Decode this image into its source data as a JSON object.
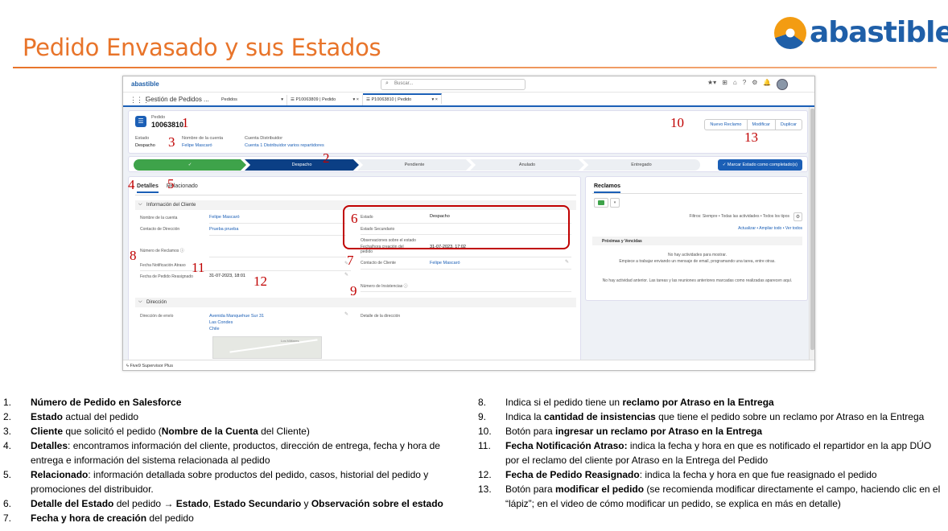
{
  "slide": {
    "title": "Pedido Envasado y sus Estados",
    "logo_text": "abastible"
  },
  "shot": {
    "sf_logo": "abastible",
    "search_placeholder": "Buscar...",
    "top_icons": [
      "★▾",
      "⊞",
      "⌂",
      "?",
      "⚙",
      "🔔"
    ],
    "app_name": "Gestión de Pedidos ...",
    "nav_tabs": [
      {
        "label": "Pedidos",
        "suffix": "▾"
      },
      {
        "label": "P10063809 | Pedido",
        "suffix": "▾ ×"
      },
      {
        "label": "P10063810 | Pedido",
        "suffix": "▾ ×"
      }
    ],
    "record": {
      "type": "Pedido",
      "number": "10063810",
      "fields": [
        {
          "label": "Estado",
          "value": "Despacho",
          "link": false
        },
        {
          "label": "Nombre de la cuenta",
          "value": "Felipe Mascaró",
          "link": true
        },
        {
          "label": "Cuenta Distribuidor",
          "value": "Cuenta 1 Distribuidor varios repartidores",
          "link": true
        }
      ],
      "buttons": [
        "Nuevo Reclamo",
        "Modificar",
        "Duplicar"
      ]
    },
    "path": {
      "stages": [
        "✓",
        "Despacho",
        "Pendiente",
        "Anulado",
        "Entregado"
      ],
      "complete_button": "✓  Marcar Estado como completado(s)"
    },
    "tabs": [
      "Detalles",
      "Relacionado"
    ],
    "sections": [
      "Información del Cliente",
      "Dirección"
    ],
    "left_fields": [
      {
        "label": "Nombre de la cuenta",
        "value": "Felipe Mascaró"
      },
      {
        "label": "Contacto de Dirección",
        "value": "Prueba prueba"
      },
      {
        "label": "Número de Reclamos ⓘ",
        "value": ""
      },
      {
        "label": "Fecha Notificación Atraso",
        "value": ""
      },
      {
        "label": "Fecha de Pedido Reasignado",
        "value": "31-07-2023, 18:01"
      }
    ],
    "right_fields": [
      {
        "label": "Estado",
        "value": "Despacho"
      },
      {
        "label": "Estado Secundario",
        "value": ""
      },
      {
        "label": "Observaciones sobre el estado",
        "value": ""
      },
      {
        "label": "Fecha/hora creación del pedido",
        "value": "31-07-2023, 17:02"
      },
      {
        "label": "Contacto de Cliente",
        "value": "Felipe Mascaró"
      },
      {
        "label": "Número de Insistencias ⓘ",
        "value": ""
      }
    ],
    "address": {
      "label": "Dirección de envío",
      "lines": [
        "Avenida Manquehue Sur 31",
        "Las Condes",
        "Chile"
      ],
      "detail_label": "Detalle de la dirección",
      "map_label": "Los Militares"
    },
    "side": {
      "title": "Reclamos",
      "filters": "Filtros: Siempre • Todas las actividades • Todos los tipos",
      "links": "Actualizar • Ampliar todo • Ver todos",
      "section": "Próximas y Vencidas",
      "empty1": "No hay actividades para mostrar.",
      "empty2": "Empiece a trabajar enviando un mensaje de email, programando una tarea, entre otras.",
      "past": "No hay actividad anterior. Las tareas y las reuniones anteriores marcadas como realizadas aparecen aquí."
    },
    "utility": "Five9 Supervisor Plus"
  },
  "callouts": [
    "1",
    "2",
    "3",
    "4",
    "5",
    "6",
    "7",
    "8",
    "9",
    "10",
    "11",
    "12",
    "13"
  ],
  "notes_left": [
    {
      "num": "1.",
      "segments": [
        {
          "t": "Número de Pedido en Salesforce",
          "b": true
        }
      ]
    },
    {
      "num": "2.",
      "segments": [
        {
          "t": "Estado",
          "b": true
        },
        {
          "t": " actual del pedido",
          "b": false
        }
      ]
    },
    {
      "num": "3.",
      "segments": [
        {
          "t": "Cliente",
          "b": true
        },
        {
          "t": " que solicitó el pedido (",
          "b": false
        },
        {
          "t": "Nombre de la Cuenta",
          "b": true
        },
        {
          "t": " del Cliente)",
          "b": false
        }
      ]
    },
    {
      "num": "4.",
      "segments": [
        {
          "t": "Detalles",
          "b": true
        },
        {
          "t": ": encontramos información del cliente, productos, dirección de entrega, fecha y hora de entrega e información del sistema relacionada al pedido",
          "b": false
        }
      ]
    },
    {
      "num": "5.",
      "segments": [
        {
          "t": "Relacionado",
          "b": true
        },
        {
          "t": ": información detallada sobre productos del pedido, casos, historial del pedido y promociones del distribuidor.",
          "b": false
        }
      ]
    },
    {
      "num": "6.",
      "segments": [
        {
          "t": "Detalle del Estado",
          "b": true
        },
        {
          "t": " del pedido ",
          "b": false
        },
        {
          "t": "→ Estado",
          "b": true
        },
        {
          "t": ", ",
          "b": false
        },
        {
          "t": "Estado Secundario",
          "b": true
        },
        {
          "t": " y ",
          "b": false
        },
        {
          "t": "Observación sobre el estado",
          "b": true
        }
      ]
    },
    {
      "num": "7.",
      "segments": [
        {
          "t": "Fecha y hora de creación",
          "b": true
        },
        {
          "t": " del pedido",
          "b": false
        }
      ]
    }
  ],
  "notes_right": [
    {
      "num": "8.",
      "segments": [
        {
          "t": "Indica si el pedido tiene un ",
          "b": false
        },
        {
          "t": "reclamo por Atraso en la Entrega",
          "b": true
        }
      ]
    },
    {
      "num": "9.",
      "segments": [
        {
          "t": "Indica la ",
          "b": false
        },
        {
          "t": "cantidad de insistencias",
          "b": true
        },
        {
          "t": " que tiene el pedido sobre un reclamo por Atraso en la Entrega",
          "b": false
        }
      ]
    },
    {
      "num": "10.",
      "segments": [
        {
          "t": "Botón para ",
          "b": false
        },
        {
          "t": "ingresar un reclamo por Atraso en la Entrega",
          "b": true
        }
      ]
    },
    {
      "num": "11.",
      "segments": [
        {
          "t": "Fecha Notificación Atraso:",
          "b": true
        },
        {
          "t": " indica la fecha y hora en que es notificado el repartidor en la app DÚO por el reclamo del cliente por Atraso en la Entrega del Pedido",
          "b": false
        }
      ]
    },
    {
      "num": "12.",
      "segments": [
        {
          "t": "Fecha de Pedido Reasignado",
          "b": true
        },
        {
          "t": ": indica la fecha y hora en que fue reasignado el pedido",
          "b": false
        }
      ]
    },
    {
      "num": "13.",
      "segments": [
        {
          "t": "Botón para ",
          "b": false
        },
        {
          "t": "modificar el pedido",
          "b": true
        },
        {
          "t": " (se recomienda modificar directamente el campo, haciendo clic en el “lápiz”; en el video de cómo modificar un pedido, se explica en más en detalle)",
          "b": false
        }
      ]
    }
  ]
}
